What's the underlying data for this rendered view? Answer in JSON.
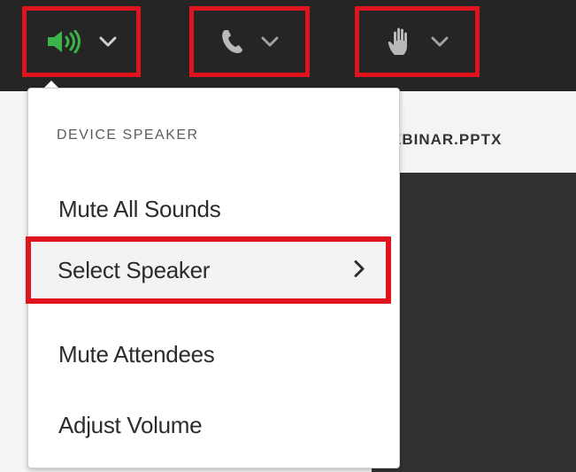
{
  "toolbar": {
    "buttons": [
      {
        "name": "speaker",
        "icon": "speaker-icon",
        "color": "#3bb54a",
        "dropdown": "chevron-down-icon"
      },
      {
        "name": "phone",
        "icon": "phone-icon",
        "color": "#b9b9b9",
        "dropdown": "chevron-down-icon"
      },
      {
        "name": "raise-hand",
        "icon": "hand-icon",
        "color": "#b9b9b9",
        "dropdown": "chevron-down-icon"
      }
    ],
    "highlight_color": "#e0141e"
  },
  "document": {
    "tab_label": "EBINAR.PPTX"
  },
  "speaker_menu": {
    "header": "DEVICE SPEAKER",
    "items": [
      {
        "label": "Mute All Sounds",
        "selected": false
      },
      {
        "label": "Select Speaker",
        "selected": true,
        "submenu": true
      },
      {
        "label": "Mute Attendees",
        "selected": false
      },
      {
        "label": "Adjust Volume",
        "selected": false
      }
    ]
  }
}
